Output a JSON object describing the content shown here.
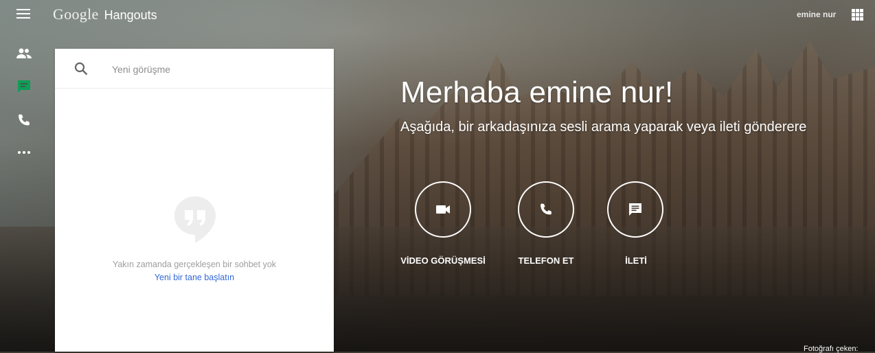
{
  "header": {
    "brand_google": "Google",
    "brand_product": "Hangouts",
    "user_name": "emine nur"
  },
  "rail": {
    "items": [
      "contacts-icon",
      "chat-icon",
      "phone-icon",
      "more-icon"
    ],
    "active": "chat-icon",
    "active_color": "#0f9d58"
  },
  "panel": {
    "search_placeholder": "Yeni görüşme",
    "empty_text": "Yakın zamanda gerçekleşen bir sohbet yok",
    "empty_link": "Yeni bir tane başlatın"
  },
  "main": {
    "greeting": "Merhaba emine nur!",
    "subgreeting": "Aşağıda, bir arkadaşınıza sesli arama yaparak veya ileti gönderere",
    "actions": [
      {
        "icon": "video-icon",
        "label": "VİDEO GÖRÜŞMESİ"
      },
      {
        "icon": "phone-icon",
        "label": "TELEFON ET"
      },
      {
        "icon": "message-icon",
        "label": "İLETİ"
      }
    ],
    "photo_credit": "Fotoğrafı çeken: "
  },
  "colors": {
    "link": "#3367d6",
    "panel_bg": "#ffffff"
  }
}
